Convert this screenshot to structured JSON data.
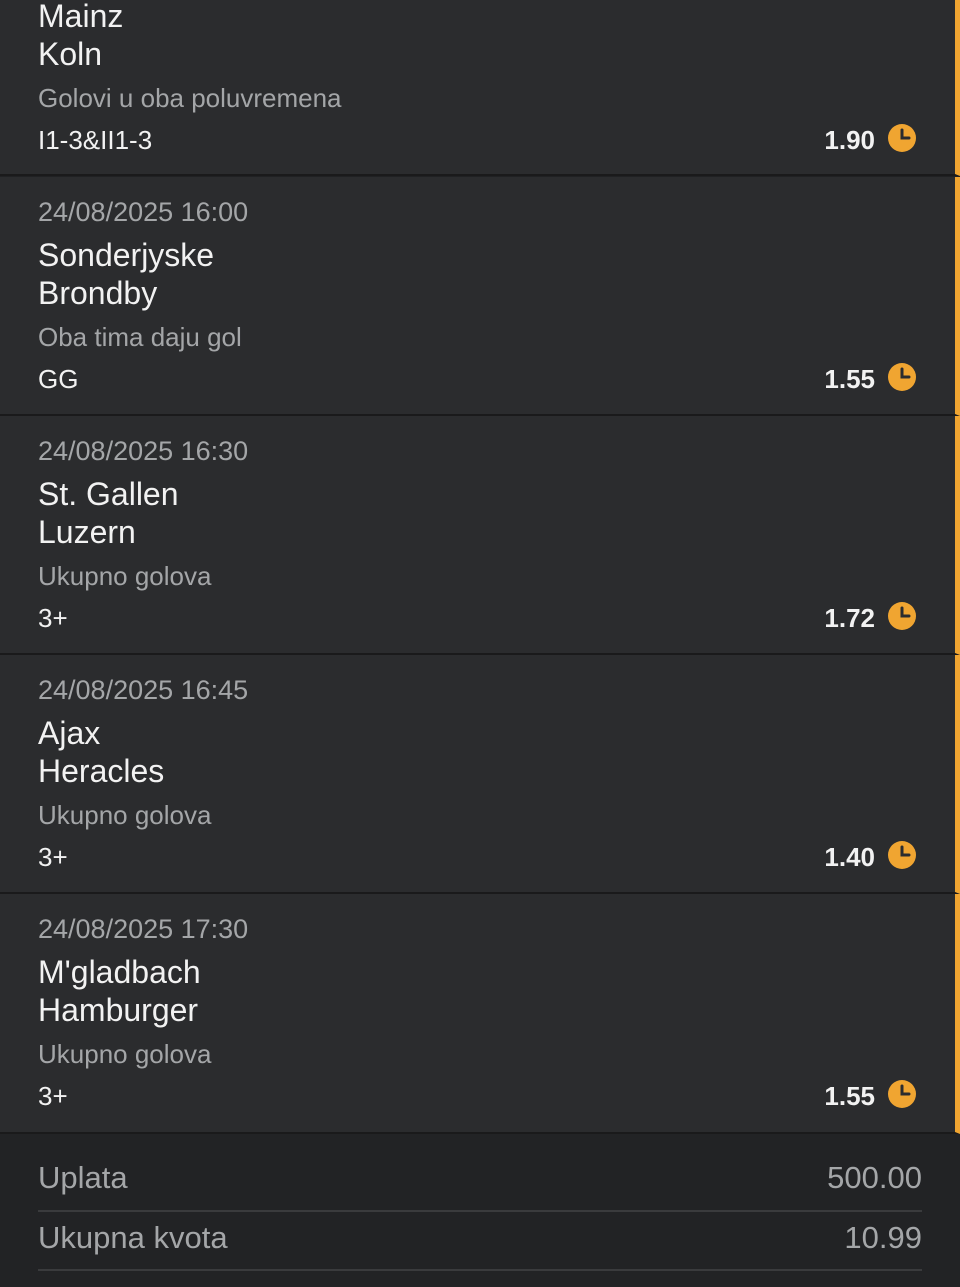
{
  "bets": [
    {
      "date": "",
      "home": "Mainz",
      "away": "Koln",
      "market": "Golovi u oba poluvremena",
      "pick": "I1-3&II1-3",
      "odds": "1.90",
      "status_icon": "clock-icon"
    },
    {
      "date": "24/08/2025 16:00",
      "home": "Sonderjyske",
      "away": "Brondby",
      "market": "Oba tima daju gol",
      "pick": "GG",
      "odds": "1.55",
      "status_icon": "clock-icon"
    },
    {
      "date": "24/08/2025 16:30",
      "home": "St. Gallen",
      "away": "Luzern",
      "market": "Ukupno golova",
      "pick": "3+",
      "odds": "1.72",
      "status_icon": "clock-icon"
    },
    {
      "date": "24/08/2025 16:45",
      "home": "Ajax",
      "away": "Heracles",
      "market": "Ukupno golova",
      "pick": "3+",
      "odds": "1.40",
      "status_icon": "clock-icon"
    },
    {
      "date": "24/08/2025 17:30",
      "home": "M'gladbach",
      "away": "Hamburger",
      "market": "Ukupno golova",
      "pick": "3+",
      "odds": "1.55",
      "status_icon": "clock-icon"
    }
  ],
  "summary": {
    "stake_label": "Uplata",
    "stake_value": "500.00",
    "total_odds_label": "Ukupna kvota",
    "total_odds_value": "10.99"
  },
  "colors": {
    "accent": "#f0a531",
    "card_bg": "#2b2c2e",
    "page_bg": "#202123",
    "text_primary": "#f2f2f2",
    "text_secondary": "#a4a6a8"
  }
}
